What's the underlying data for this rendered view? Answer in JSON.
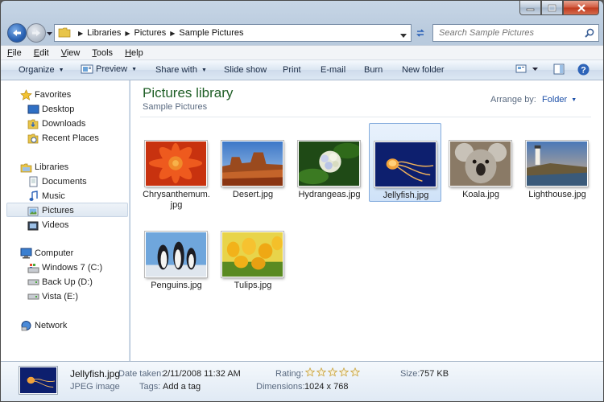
{
  "window": {
    "caption_buttons": [
      "minimize",
      "maximize",
      "close"
    ]
  },
  "address_bar": {
    "breadcrumbs": [
      "Libraries",
      "Pictures",
      "Sample Pictures"
    ],
    "search_placeholder": "Search Sample Pictures"
  },
  "menu": {
    "items": [
      {
        "label": "File",
        "key": "F",
        "rest": "ile"
      },
      {
        "label": "Edit",
        "key": "E",
        "rest": "dit"
      },
      {
        "label": "View",
        "key": "V",
        "rest": "iew"
      },
      {
        "label": "Tools",
        "key": "T",
        "rest": "ools"
      },
      {
        "label": "Help",
        "key": "H",
        "rest": "elp"
      }
    ]
  },
  "toolbar": {
    "organize": "Organize",
    "preview": "Preview",
    "share_with": "Share with",
    "slide_show": "Slide show",
    "print": "Print",
    "email": "E-mail",
    "burn": "Burn",
    "new_folder": "New folder"
  },
  "navigation": {
    "favorites": {
      "label": "Favorites",
      "items": [
        "Desktop",
        "Downloads",
        "Recent Places"
      ]
    },
    "libraries": {
      "label": "Libraries",
      "items": [
        "Documents",
        "Music",
        "Pictures",
        "Videos"
      ],
      "selected": "Pictures"
    },
    "computer": {
      "label": "Computer",
      "items": [
        "Windows 7 (C:)",
        "Back Up (D:)",
        "Vista (E:)"
      ]
    },
    "network": {
      "label": "Network"
    }
  },
  "content": {
    "title": "Pictures library",
    "subtitle": "Sample Pictures",
    "arrange_label": "Arrange by:",
    "arrange_value": "Folder",
    "files": [
      {
        "label_line1": "Chrysanthemum.",
        "label_line2": "jpg"
      },
      {
        "label_line1": "Desert.jpg",
        "label_line2": ""
      },
      {
        "label_line1": "Hydrangeas.jpg",
        "label_line2": ""
      },
      {
        "label_line1": "Jellyfish.jpg",
        "label_line2": "",
        "selected": true
      },
      {
        "label_line1": "Koala.jpg",
        "label_line2": ""
      },
      {
        "label_line1": "Lighthouse.jpg",
        "label_line2": ""
      },
      {
        "label_line1": "Penguins.jpg",
        "label_line2": ""
      },
      {
        "label_line1": "Tulips.jpg",
        "label_line2": ""
      }
    ]
  },
  "details": {
    "name": "Jellyfish.jpg",
    "type": "JPEG image",
    "date_label": "Date taken:",
    "date_value": "2/11/2008 11:32 AM",
    "tags_label": "Tags:",
    "tags_value": "Add a tag",
    "rating_label": "Rating:",
    "rating_value": 0,
    "rating_max": 5,
    "dimensions_label": "Dimensions:",
    "dimensions_value": "1024 x 768",
    "size_label": "Size:",
    "size_value": "757 KB"
  },
  "colors": {
    "library_title": "#1e5e25",
    "link_blue": "#1c4fa8",
    "selection": "#cfe2f8"
  }
}
